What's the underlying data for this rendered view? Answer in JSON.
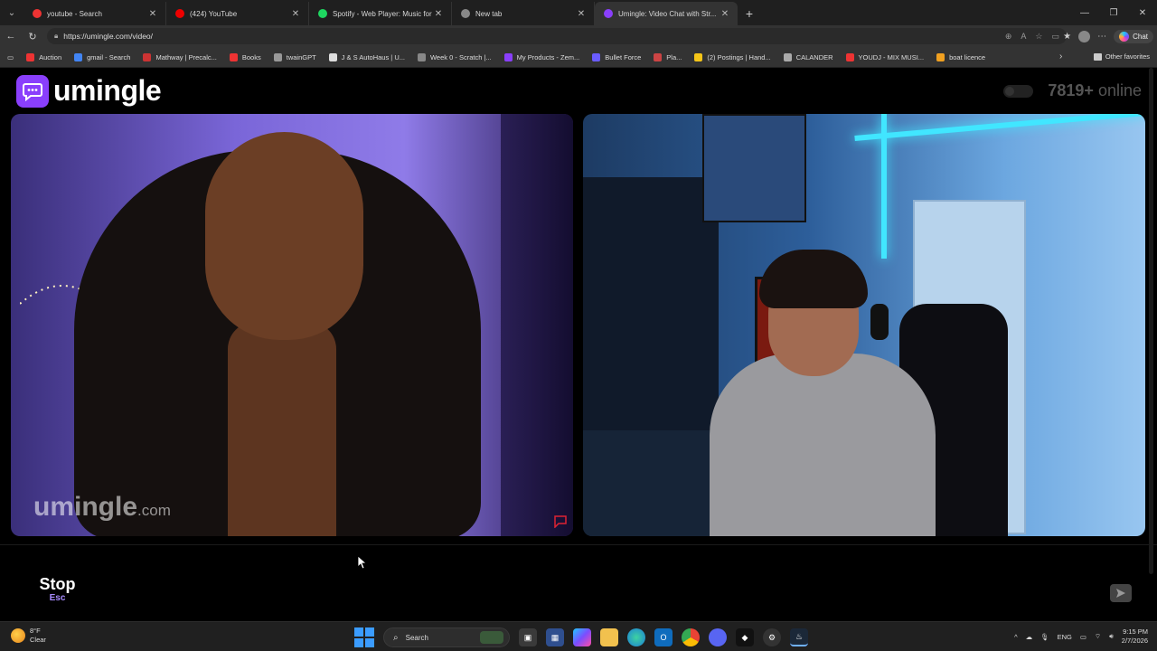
{
  "browser": {
    "tabs": [
      {
        "title": "youtube - Search",
        "fav_color": "#e33",
        "active": false
      },
      {
        "title": "(424) YouTube",
        "fav_color": "#e00",
        "active": false
      },
      {
        "title": "Spotify - Web Player: Music for ev...",
        "fav_color": "#1ed760",
        "active": false
      },
      {
        "title": "New tab",
        "fav_color": "#888",
        "active": false
      },
      {
        "title": "Umingle: Video Chat with Str...",
        "fav_color": "#8a3ffc",
        "active": true
      }
    ],
    "url": "https://umingle.com/video/",
    "copilot_label": "Chat",
    "bookmarks": [
      {
        "label": "Auction",
        "color": "#e33"
      },
      {
        "label": "gmail - Search",
        "color": "#4285f4"
      },
      {
        "label": "Mathway | Precalc...",
        "color": "#c33"
      },
      {
        "label": "Books",
        "color": "#e33"
      },
      {
        "label": "twainGPT",
        "color": "#999"
      },
      {
        "label": "J & S AutoHaus | U...",
        "color": "#ddd"
      },
      {
        "label": "Week 0 - Scratch |...",
        "color": "#888"
      },
      {
        "label": "My Products - Zem...",
        "color": "#8a3ffc"
      },
      {
        "label": "Bullet Force",
        "color": "#6a5cff"
      },
      {
        "label": "Pla...",
        "color": "#c44"
      },
      {
        "label": "(2) Postings | Hand...",
        "color": "#f5c518"
      },
      {
        "label": "CALANDER",
        "color": "#aaa"
      },
      {
        "label": "YOUDJ - MIX MUSI...",
        "color": "#e33"
      },
      {
        "label": "boat licence",
        "color": "#f0a020"
      }
    ],
    "other_favorites": "Other favorites"
  },
  "page": {
    "logo_text": "umingle",
    "online_count": "7819+",
    "online_label": "online",
    "watermark": "umingle",
    "watermark_suffix": ".com",
    "stop_label": "Stop",
    "stop_key": "Esc",
    "chat_placeholder": "",
    "accent": "#8a3ffc"
  },
  "taskbar": {
    "weather_temp": "8°F",
    "weather_desc": "Clear",
    "search_label": "Search",
    "lang": "ENG",
    "time": "9:15 PM",
    "date": "2/7/2026"
  }
}
